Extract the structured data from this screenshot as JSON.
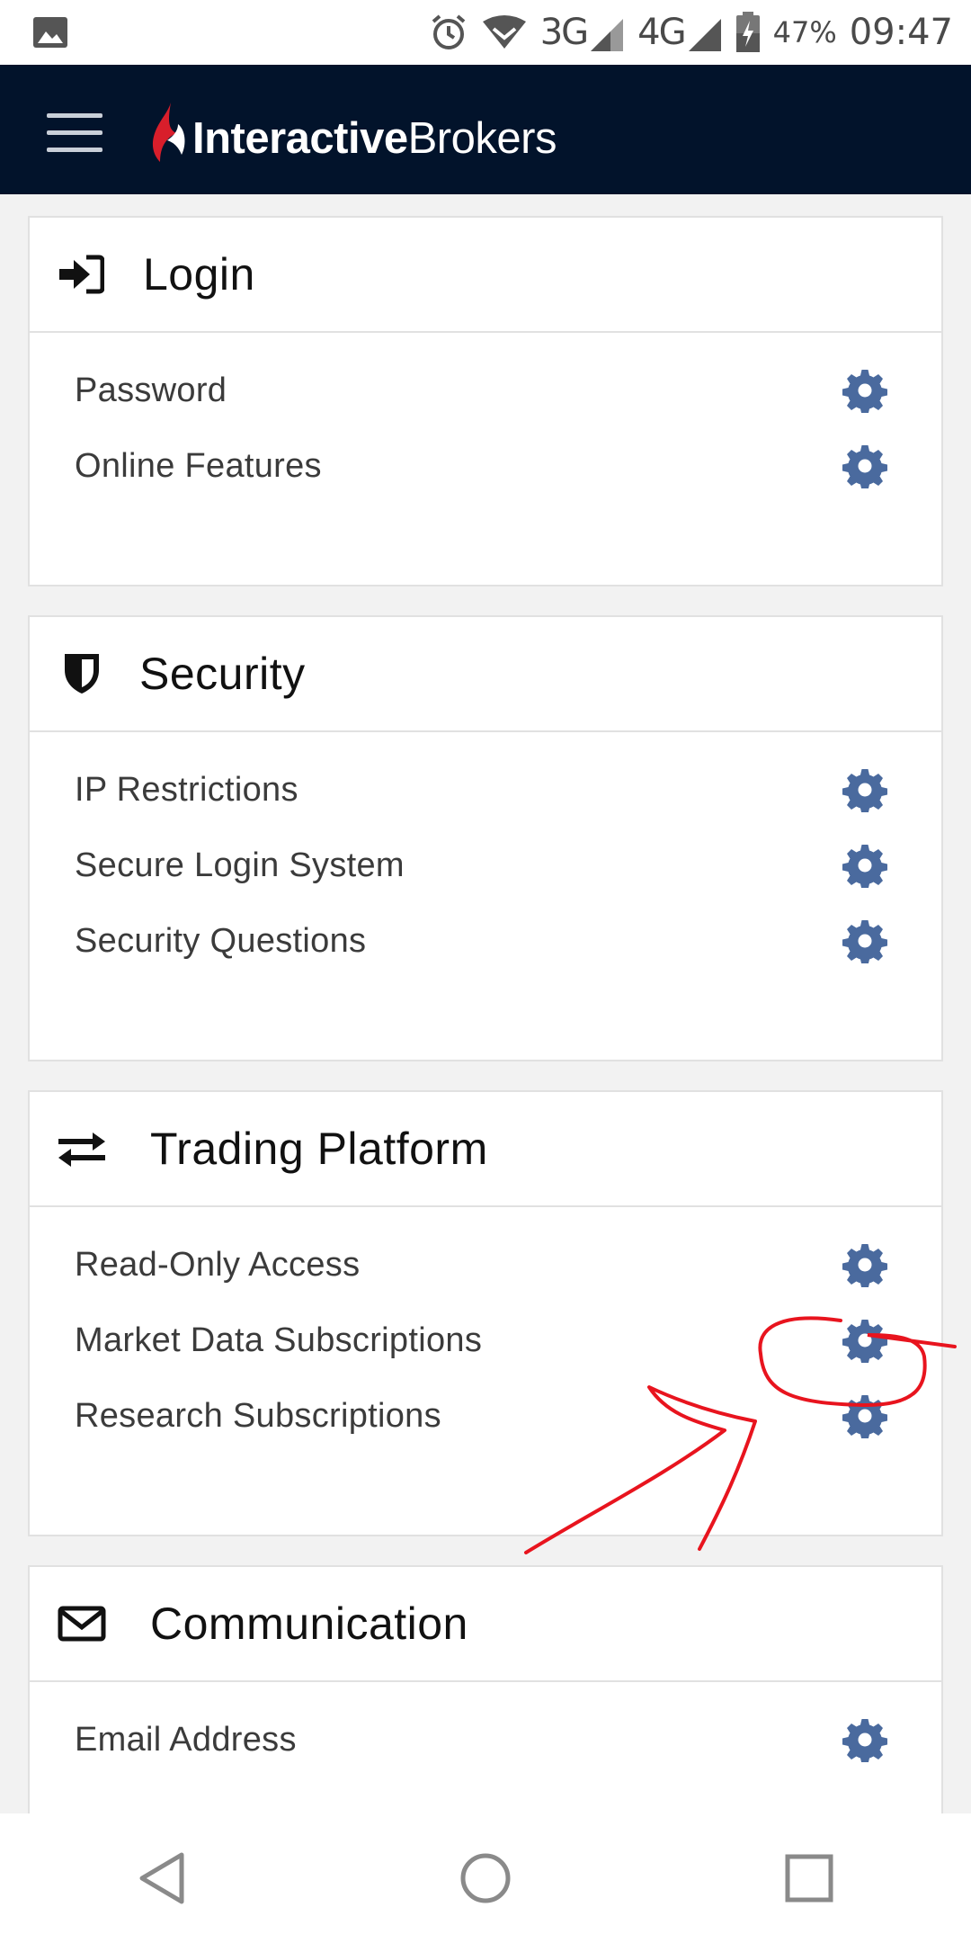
{
  "status_bar": {
    "net1": "3G",
    "net2": "4G",
    "battery": "47%",
    "time": "09:47"
  },
  "header": {
    "brand_bold": "Interactive",
    "brand_regular": "Brokers"
  },
  "sections": [
    {
      "title": "Login",
      "icon": "sign-in-icon",
      "items": [
        "Password",
        "Online Features"
      ]
    },
    {
      "title": "Security",
      "icon": "shield-icon",
      "items": [
        "IP Restrictions",
        "Secure Login System",
        "Security Questions"
      ]
    },
    {
      "title": "Trading Platform",
      "icon": "exchange-arrows-icon",
      "items": [
        "Read-Only Access",
        "Market Data Subscriptions",
        "Research Subscriptions"
      ]
    },
    {
      "title": "Communication",
      "icon": "envelope-icon",
      "items": [
        "Email Address"
      ]
    }
  ],
  "colors": {
    "header_bg": "#02132b",
    "gear": "#4a6a9e",
    "brand_red": "#d81e2b",
    "annotation": "#e8141e"
  }
}
